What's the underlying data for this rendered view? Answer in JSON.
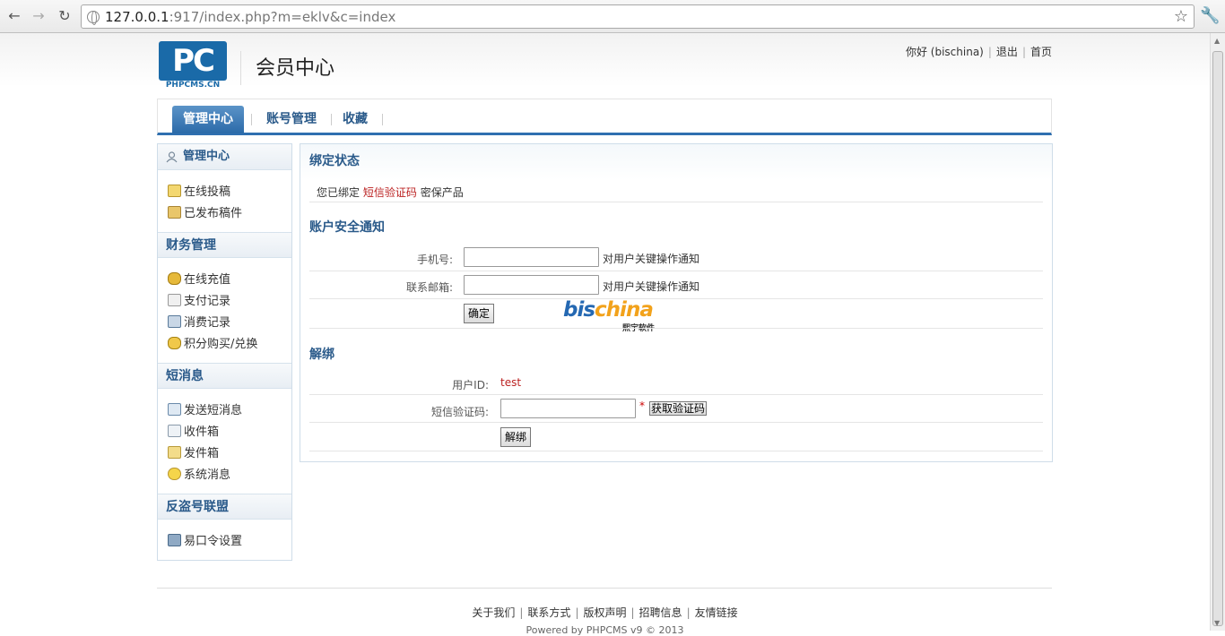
{
  "browser": {
    "url_host": "127.0.0.1",
    "url_rest": ":917/index.php?m=eklv&c=index"
  },
  "header": {
    "logo_text": "PC",
    "logo_sub": "PHPCMS.CN",
    "title": "会员中心",
    "greeting": "你好 (bischina)",
    "logout": "退出",
    "home": "首页"
  },
  "tabs": [
    {
      "label": "管理中心"
    },
    {
      "label": "账号管理"
    },
    {
      "label": "收藏"
    }
  ],
  "sidebar": {
    "sections": [
      {
        "title": "管理中心",
        "items": [
          "在线投稿",
          "已发布稿件"
        ]
      },
      {
        "title": "财务管理",
        "items": [
          "在线充值",
          "支付记录",
          "消费记录",
          "积分购买/兑换"
        ]
      },
      {
        "title": "短消息",
        "items": [
          "发送短消息",
          "收件箱",
          "发件箱",
          "系统消息"
        ]
      },
      {
        "title": "反盗号联盟",
        "items": [
          "易口令设置"
        ]
      }
    ]
  },
  "main": {
    "bind_status": {
      "title": "绑定状态",
      "text_prefix": "您已绑定",
      "product": "短信验证码",
      "text_suffix": "密保产品"
    },
    "notify": {
      "title": "账户安全通知",
      "phone_label": "手机号:",
      "phone_note": "对用户关键操作通知",
      "email_label": "联系邮箱:",
      "email_note": "对用户关键操作通知",
      "confirm_button": "确定"
    },
    "unbind": {
      "title": "解绑",
      "userid_label": "用户ID:",
      "userid_value": "test",
      "code_label": "短信验证码:",
      "required_mark": "*",
      "get_code_button": "获取验证码",
      "unbind_button": "解绑"
    },
    "watermark": {
      "text_a": "bis",
      "text_b": "china",
      "sub": "熙宇软件"
    }
  },
  "footer": {
    "links": [
      "关于我们",
      "联系方式",
      "版权声明",
      "招聘信息",
      "友情链接"
    ],
    "powered": "Powered by PHPCMS v9 © 2013"
  }
}
